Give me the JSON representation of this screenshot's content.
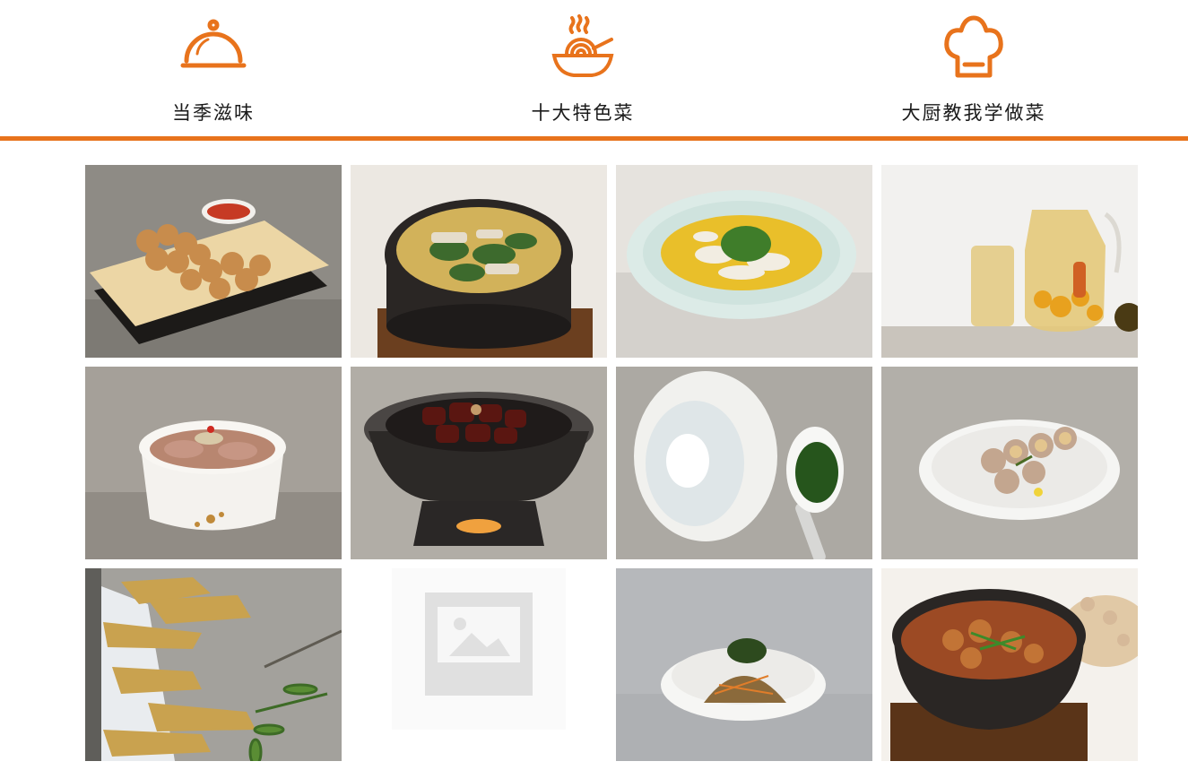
{
  "theme": {
    "accent": "#e8731c"
  },
  "nav": {
    "items": [
      {
        "label": "当季滋味",
        "icon": "cloche-icon"
      },
      {
        "label": "十大特色菜",
        "icon": "noodle-bowl-icon"
      },
      {
        "label": "大厨教我学做菜",
        "icon": "chef-hat-icon"
      }
    ]
  },
  "gallery": {
    "items": [
      {
        "icon": "fried-balls-dish-image"
      },
      {
        "icon": "clay-pot-greens-soup-image"
      },
      {
        "icon": "fish-soup-bowl-image"
      },
      {
        "icon": "fruit-tea-jug-image"
      },
      {
        "icon": "sliced-meat-bowl-image"
      },
      {
        "icon": "braised-pork-pot-image"
      },
      {
        "icon": "dumpling-spoon-image"
      },
      {
        "icon": "chestnut-plate-image"
      },
      {
        "icon": "bamboo-shoots-image"
      },
      {
        "icon": "image-placeholder-icon"
      },
      {
        "icon": "noodle-salad-bowl-image"
      },
      {
        "icon": "stew-clay-pot-image"
      }
    ]
  }
}
